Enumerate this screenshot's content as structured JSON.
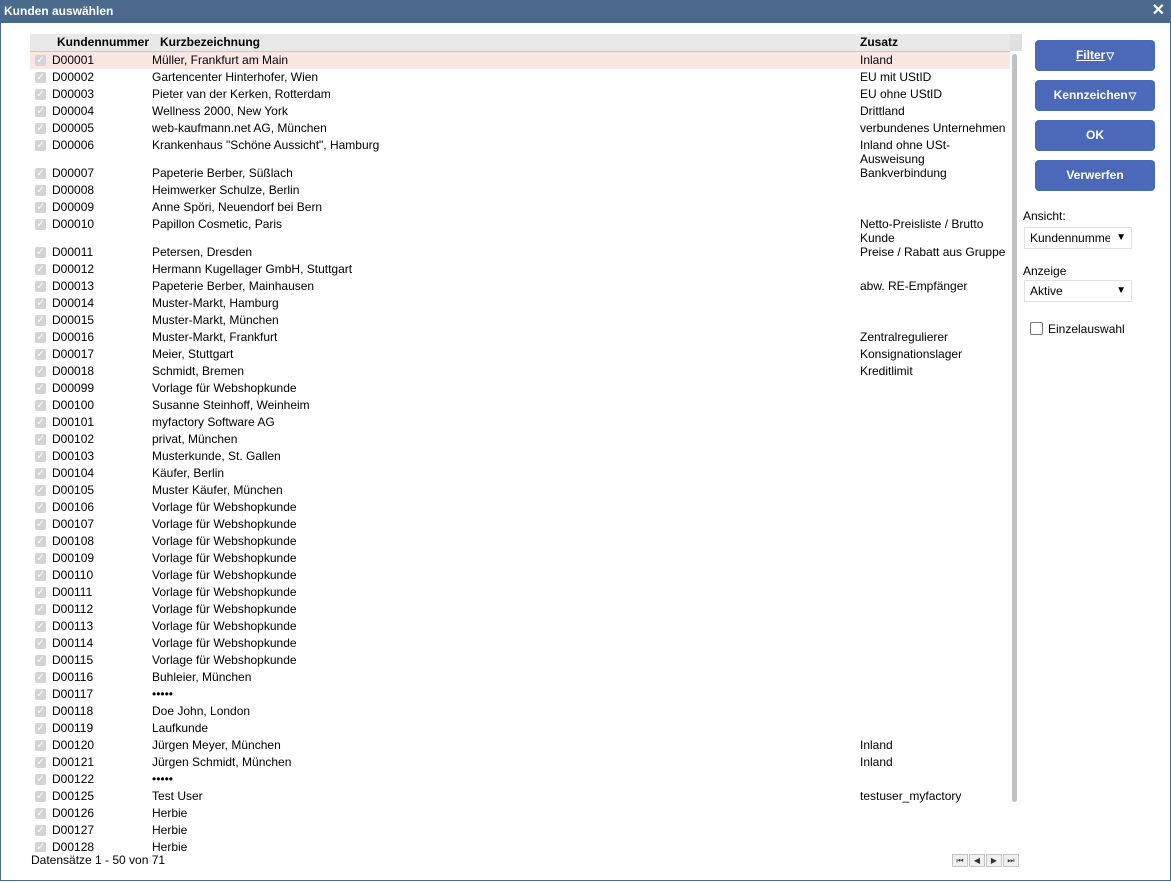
{
  "window": {
    "title": "Kunden auswählen",
    "close_glyph": "✕"
  },
  "grid": {
    "columns": [
      "Kundennummer",
      "Kurzbezeichnung",
      "Zusatz"
    ],
    "rows": [
      {
        "nr": "D00001",
        "kb": "Müller, Frankfurt am Main",
        "zs": "Inland"
      },
      {
        "nr": "D00002",
        "kb": "Gartencenter Hinterhofer, Wien",
        "zs": "EU mit UStID"
      },
      {
        "nr": "D00003",
        "kb": "Pieter van der Kerken, Rotterdam",
        "zs": "EU ohne UStID"
      },
      {
        "nr": "D00004",
        "kb": "Wellness 2000, New York",
        "zs": "Drittland"
      },
      {
        "nr": "D00005",
        "kb": "web-kaufmann.net AG, München",
        "zs": "verbundenes Unternehmen"
      },
      {
        "nr": "D00006",
        "kb": "Krankenhaus \"Schöne Aussicht\", Hamburg",
        "zs": "Inland ohne USt-Ausweisung"
      },
      {
        "nr": "D00007",
        "kb": "Papeterie Berber, Süßlach",
        "zs": "Bankverbindung"
      },
      {
        "nr": "D00008",
        "kb": "Heimwerker Schulze, Berlin",
        "zs": ""
      },
      {
        "nr": "D00009",
        "kb": "Anne Spöri, Neuendorf bei Bern",
        "zs": ""
      },
      {
        "nr": "D00010",
        "kb": "Papillon Cosmetic, Paris",
        "zs": "Netto-Preisliste / Brutto Kunde"
      },
      {
        "nr": "D00011",
        "kb": "Petersen, Dresden",
        "zs": "Preise / Rabatt aus Gruppe"
      },
      {
        "nr": "D00012",
        "kb": "Hermann Kugellager GmbH, Stuttgart",
        "zs": ""
      },
      {
        "nr": "D00013",
        "kb": "Papeterie Berber, Mainhausen",
        "zs": "abw. RE-Empfänger"
      },
      {
        "nr": "D00014",
        "kb": "Muster-Markt, Hamburg",
        "zs": ""
      },
      {
        "nr": "D00015",
        "kb": "Muster-Markt, München",
        "zs": ""
      },
      {
        "nr": "D00016",
        "kb": "Muster-Markt, Frankfurt",
        "zs": "Zentralregulierer"
      },
      {
        "nr": "D00017",
        "kb": "Meier, Stuttgart",
        "zs": "Konsignationslager"
      },
      {
        "nr": "D00018",
        "kb": "Schmidt, Bremen",
        "zs": "Kreditlimit"
      },
      {
        "nr": "D00099",
        "kb": "Vorlage für Webshopkunde",
        "zs": ""
      },
      {
        "nr": "D00100",
        "kb": "Susanne Steinhoff, Weinheim",
        "zs": ""
      },
      {
        "nr": "D00101",
        "kb": "myfactory Software AG",
        "zs": ""
      },
      {
        "nr": "D00102",
        "kb": "privat, München",
        "zs": ""
      },
      {
        "nr": "D00103",
        "kb": "Musterkunde, St. Gallen",
        "zs": ""
      },
      {
        "nr": "D00104",
        "kb": "Käufer, Berlin",
        "zs": ""
      },
      {
        "nr": "D00105",
        "kb": "Muster Käufer, München",
        "zs": ""
      },
      {
        "nr": "D00106",
        "kb": "Vorlage für Webshopkunde",
        "zs": ""
      },
      {
        "nr": "D00107",
        "kb": "Vorlage für Webshopkunde",
        "zs": ""
      },
      {
        "nr": "D00108",
        "kb": "Vorlage für Webshopkunde",
        "zs": ""
      },
      {
        "nr": "D00109",
        "kb": "Vorlage für Webshopkunde",
        "zs": ""
      },
      {
        "nr": "D00110",
        "kb": "Vorlage für Webshopkunde",
        "zs": ""
      },
      {
        "nr": "D00111",
        "kb": "Vorlage für Webshopkunde",
        "zs": ""
      },
      {
        "nr": "D00112",
        "kb": "Vorlage für Webshopkunde",
        "zs": ""
      },
      {
        "nr": "D00113",
        "kb": "Vorlage für Webshopkunde",
        "zs": ""
      },
      {
        "nr": "D00114",
        "kb": "Vorlage für Webshopkunde",
        "zs": ""
      },
      {
        "nr": "D00115",
        "kb": "Vorlage für Webshopkunde",
        "zs": ""
      },
      {
        "nr": "D00116",
        "kb": "Buhleier, München",
        "zs": ""
      },
      {
        "nr": "D00117",
        "kb": "•••••",
        "zs": ""
      },
      {
        "nr": "D00118",
        "kb": "Doe John, London",
        "zs": ""
      },
      {
        "nr": "D00119",
        "kb": "Laufkunde",
        "zs": ""
      },
      {
        "nr": "D00120",
        "kb": "Jürgen Meyer, München",
        "zs": "Inland"
      },
      {
        "nr": "D00121",
        "kb": "Jürgen Schmidt, München",
        "zs": "Inland"
      },
      {
        "nr": "D00122",
        "kb": "•••••",
        "zs": ""
      },
      {
        "nr": "D00125",
        "kb": "Test User",
        "zs": "testuser_myfactory"
      },
      {
        "nr": "D00126",
        "kb": "Herbie",
        "zs": ""
      },
      {
        "nr": "D00127",
        "kb": "Herbie",
        "zs": ""
      },
      {
        "nr": "D00128",
        "kb": "Herbie",
        "zs": ""
      }
    ],
    "selected_row": 0,
    "tall_rows": [
      5,
      9
    ]
  },
  "footer": {
    "record_info": "Datensätze 1 - 50 von 71"
  },
  "pager": {
    "first": "⏮",
    "prev": "◀",
    "next": "▶",
    "last": "⏭"
  },
  "buttons": {
    "filter": "Filter",
    "kennzeichen": "Kennzeichen",
    "ok": "OK",
    "verwerfen": "Verwerfen",
    "funnel_glyph": "▽"
  },
  "view": {
    "label": "Ansicht:",
    "value": "Kundennummer"
  },
  "display": {
    "label": "Anzeige",
    "value": "Aktive"
  },
  "single_select": {
    "label": "Einzelauswahl",
    "checked": false
  },
  "colors": {
    "titlebar": "#4b6a8b",
    "button": "#4b69b8",
    "selected_row": "#fae7e4"
  }
}
